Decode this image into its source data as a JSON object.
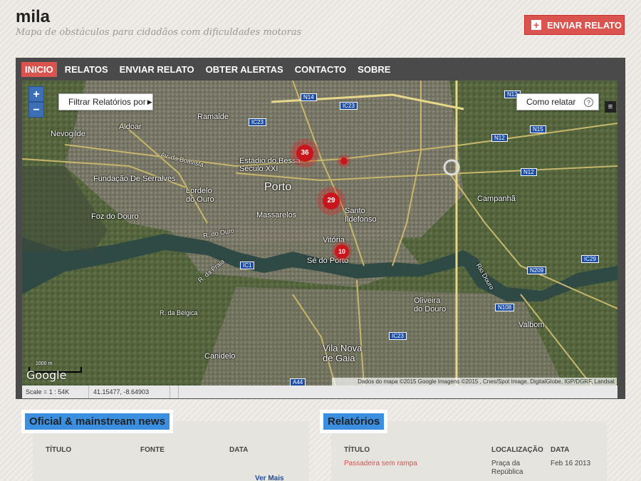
{
  "header": {
    "title": "mila",
    "tagline": "Mapa de obstáculos para cidadãos com dificuldades motoras",
    "send_button": "ENVIAR RELATO"
  },
  "nav": {
    "items": [
      {
        "label": "INICIO",
        "active": true
      },
      {
        "label": "RELATOS",
        "active": false
      },
      {
        "label": "ENVIAR RELATO",
        "active": false
      },
      {
        "label": "OBTER ALERTAS",
        "active": false
      },
      {
        "label": "CONTACTO",
        "active": false
      },
      {
        "label": "SOBRE",
        "active": false
      }
    ]
  },
  "map": {
    "zoom_in": "+",
    "zoom_out": "−",
    "filter_label": "Filtrar Relatórios por",
    "howto_label": "Como relatar",
    "howto_icon": "?",
    "clusters": [
      {
        "count": "36"
      },
      {
        "count": ""
      },
      {
        "count": "29"
      },
      {
        "count": "10"
      }
    ],
    "places": {
      "ramalde": "Ramalde",
      "aldoar": "Aldoar",
      "nevogilde": "Nevogilde",
      "porto": "Porto",
      "boavista": "Av. da Boavista",
      "bessa": "Estádio do Bessa Século XXI",
      "serralves": "Fundação De Serralves",
      "lordelo": "Lordelo do Ouro",
      "massarelos": "Massarelos",
      "foz": "Foz do Douro",
      "santo_ildefonso": "Santo Ildefonso",
      "vitoria": "Vitória",
      "se": "Sé do Porto",
      "campanha": "Campanhã",
      "oliveira": "Oliveira do Douro",
      "valbom": "Valbom",
      "vila_nova": "Vila Nova de Gaia",
      "canidelo": "Canidelo",
      "belgica": "R. da Bélgica",
      "praia": "R. da Praia",
      "rio_douro": "Rio Douro",
      "r_ouro": "R. do Ouro"
    },
    "shields": [
      "N14",
      "IC23",
      "IC23",
      "N12",
      "N15",
      "N12",
      "N12",
      "IC29",
      "N209",
      "N108",
      "IC23",
      "IC1",
      "A44"
    ],
    "google_logo": "Google",
    "scale_text": "1000 m",
    "attribution": "Dados do mapa ©2015 Google Imagens ©2015 , Cnes/Spot Image, DigitalGlobe, IGP/DGRF, Landsat",
    "status_scale": "Scale = 1 : 54K",
    "status_coords": "41.15477, -8.64903"
  },
  "news_panel": {
    "title": "Oficial & mainstream news",
    "columns": [
      "TÍTULO",
      "FONTE",
      "DATA"
    ],
    "more_link": "Ver Mais"
  },
  "reports_panel": {
    "title": "Relatórios",
    "columns": [
      "TÍTULO",
      "LOCALIZAÇÃO",
      "DATA"
    ],
    "rows": [
      {
        "title": "Passadeira sem rampa",
        "location": "Praça da República",
        "date": "Feb 16 2013"
      }
    ]
  },
  "colors": {
    "accent": "#d9534f",
    "nav_bg": "#4a4a4a",
    "panel_title_bg": "#3b8fe0",
    "cluster": "#c9161c"
  }
}
